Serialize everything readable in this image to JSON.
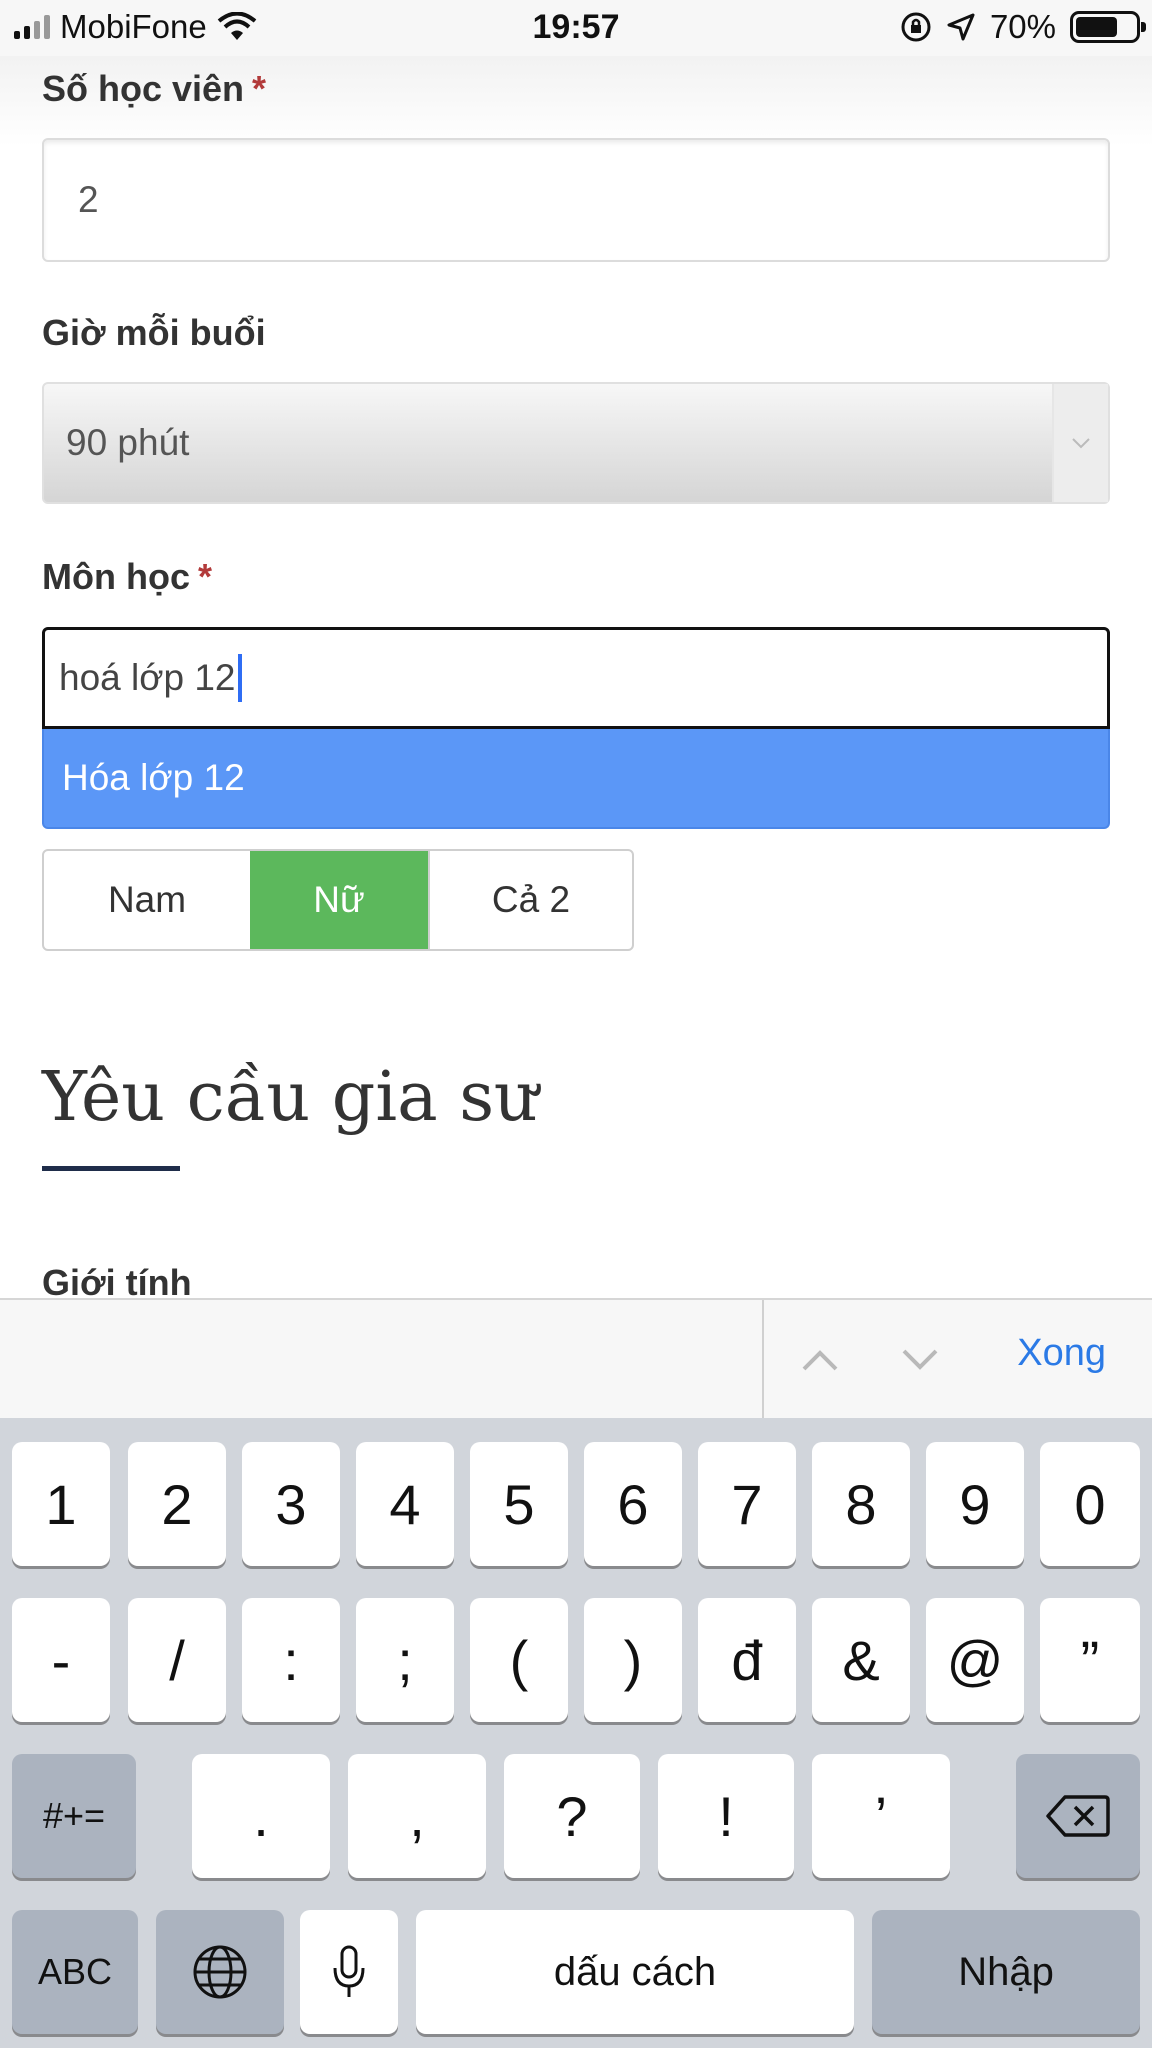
{
  "status_bar": {
    "carrier": "MobiFone",
    "time": "19:57",
    "battery": "70%"
  },
  "form": {
    "students_label": "Số học viên",
    "students_value": "2",
    "duration_label": "Giờ mỗi buổi",
    "duration_value": "90 phút",
    "subject_label": "Môn học",
    "required_mark": "*",
    "subject_value": "hoá lớp 12",
    "subject_suggestion": "Hóa lớp 12",
    "gender_options": [
      "Nam",
      "Nữ",
      "Cả 2"
    ],
    "gender_selected": "Nữ",
    "tutor_heading": "Yêu cầu gia sư",
    "tutor_gender_label": "Giới tính"
  },
  "accessory": {
    "done_label": "Xong"
  },
  "keyboard": {
    "row1": [
      "1",
      "2",
      "3",
      "4",
      "5",
      "6",
      "7",
      "8",
      "9",
      "0"
    ],
    "row2": [
      "-",
      "/",
      ":",
      ";",
      "(",
      ")",
      "đ",
      "&",
      "@",
      "”"
    ],
    "row3": [
      ".",
      ",",
      "?",
      "!",
      "’"
    ],
    "symbols_key": "#+=",
    "abc_key": "ABC",
    "space_key": "dấu cách",
    "return_key": "Nhập"
  },
  "colors": {
    "suggestion_bg": "#5b97f7",
    "selected_gender_bg": "#5cb85c",
    "done_link": "#2b7ae6",
    "required": "#b23a3a"
  }
}
